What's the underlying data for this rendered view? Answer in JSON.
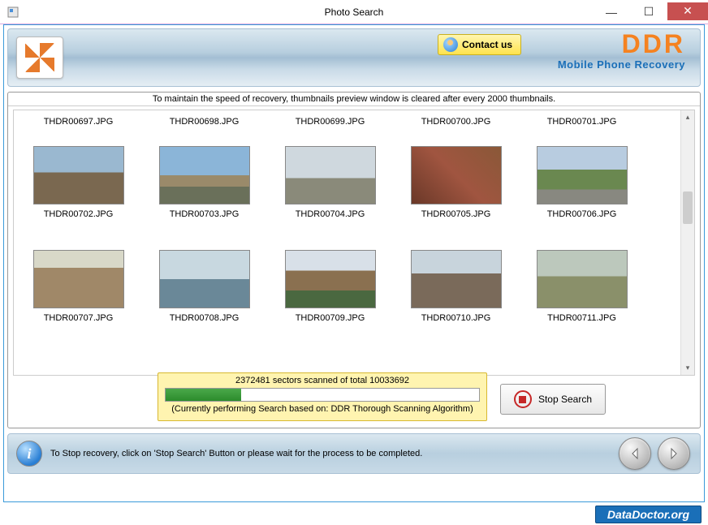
{
  "titlebar": {
    "title": "Photo Search"
  },
  "banner": {
    "contact_label": "Contact us",
    "brand_main": "DDR",
    "brand_sub": "Mobile Phone Recovery"
  },
  "info_strip": "To maintain the speed of recovery, thumbnails preview window is cleared after every 2000 thumbnails.",
  "thumbnails": {
    "row_labels_top": [
      "THDR00697.JPG",
      "THDR00698.JPG",
      "THDR00699.JPG",
      "THDR00700.JPG",
      "THDR00701.JPG"
    ],
    "row1": [
      "THDR00702.JPG",
      "THDR00703.JPG",
      "THDR00704.JPG",
      "THDR00705.JPG",
      "THDR00706.JPG"
    ],
    "row2": [
      "THDR00707.JPG",
      "THDR00708.JPG",
      "THDR00709.JPG",
      "THDR00710.JPG",
      "THDR00711.JPG"
    ]
  },
  "progress": {
    "sectors_text": "2372481 sectors scanned of total 10033692",
    "algorithm_text": "(Currently performing Search based on:  DDR Thorough Scanning Algorithm)",
    "percent": 24
  },
  "stop_button": "Stop Search",
  "footer": {
    "hint": "To Stop recovery, click on 'Stop Search' Button or please wait for the process to be completed."
  },
  "watermark": "DataDoctor.org"
}
